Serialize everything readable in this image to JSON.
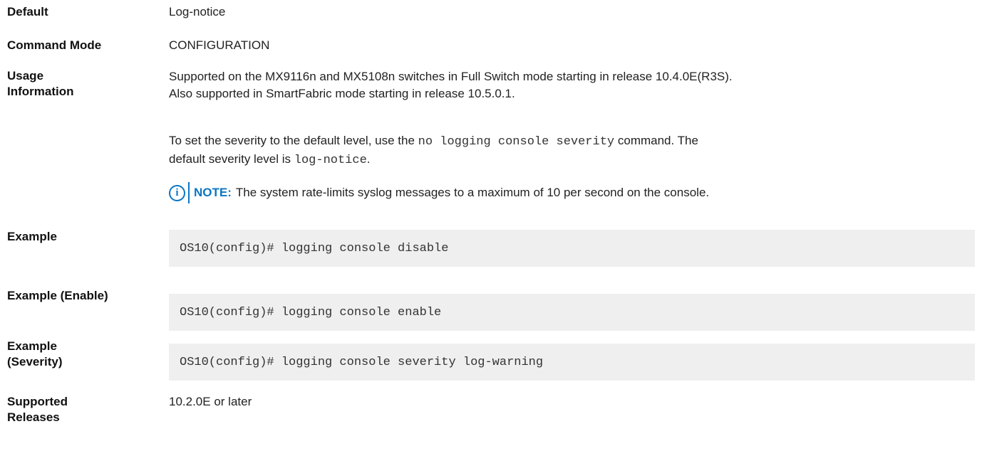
{
  "rows": {
    "default": {
      "label": "Default",
      "value": "Log-notice"
    },
    "command_mode": {
      "label": "Command Mode",
      "value": "CONFIGURATION"
    },
    "usage": {
      "label_line1": "Usage",
      "label_line2": "Information",
      "para1_line1": "Supported on the MX9116n and MX5108n switches in Full Switch mode starting in release 10.4.0E(R3S).",
      "para1_line2": "Also supported in SmartFabric mode starting in release 10.5.0.1.",
      "para2_pre": "To set the severity to the default level, use the",
      "para2_code": "no logging console severity",
      "para2_post": "command. The",
      "para2_line2_pre": "default severity level is",
      "para2_line2_code": "log-notice",
      "para2_line2_post": ".",
      "note_label": "NOTE:",
      "note_text": "The system rate-limits syslog messages to a maximum of 10 per second on the console."
    },
    "example": {
      "label": "Example",
      "code": "OS10(config)# logging console disable"
    },
    "example_enable": {
      "label": "Example (Enable)",
      "code": "OS10(config)# logging console enable"
    },
    "example_severity": {
      "label_line1": "Example",
      "label_line2": "(Severity)",
      "code": "OS10(config)# logging console severity log-warning"
    },
    "supported": {
      "label_line1": "Supported",
      "label_line2": "Releases",
      "value": "10.2.0E or later"
    }
  },
  "icons": {
    "note": "info-icon"
  },
  "colors": {
    "accent": "#0b76c4",
    "code_bg": "#efefef"
  }
}
